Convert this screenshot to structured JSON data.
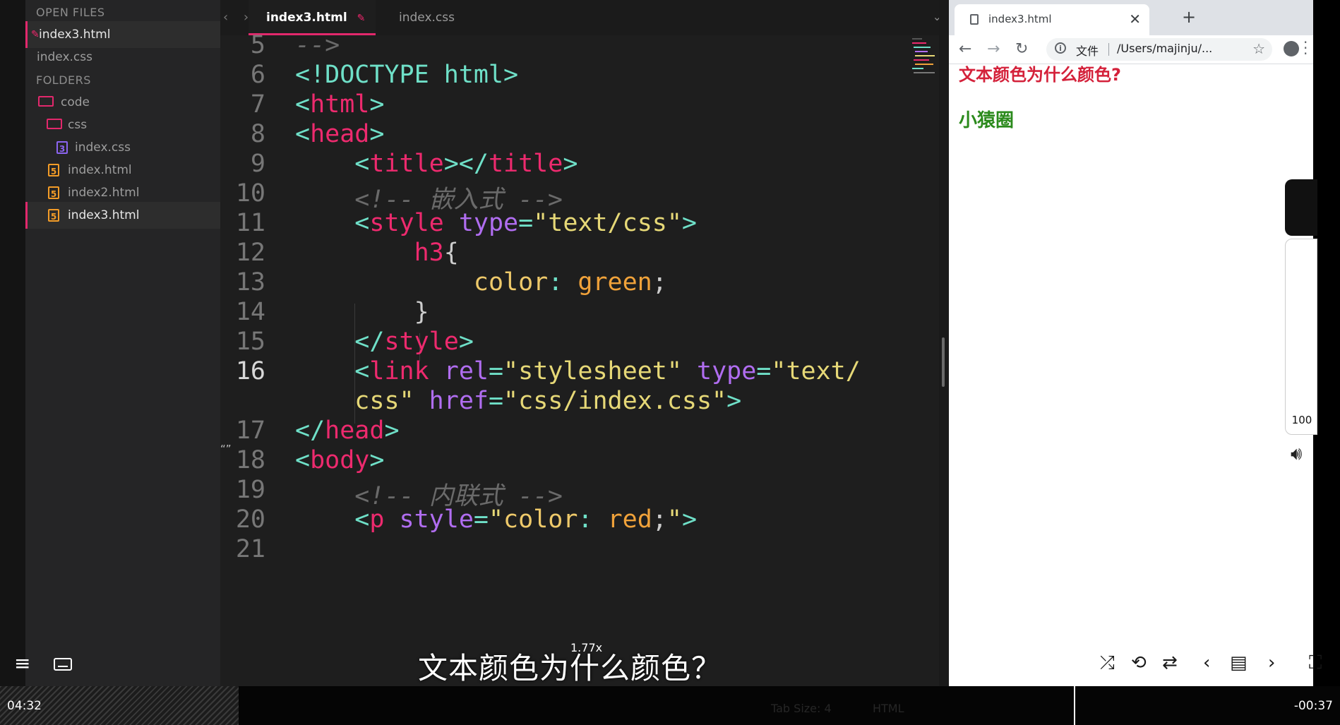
{
  "sidebar": {
    "open_files_heading": "OPEN FILES",
    "open_files": [
      {
        "name": "index3.html",
        "modified": true
      },
      {
        "name": "index.css",
        "modified": false
      }
    ],
    "folders_heading": "FOLDERS",
    "tree": [
      {
        "name": "code",
        "type": "folder"
      },
      {
        "name": "css",
        "type": "folder"
      },
      {
        "name": "index.css",
        "type": "css-file"
      },
      {
        "name": "index.html",
        "type": "html-file"
      },
      {
        "name": "index2.html",
        "type": "html-file"
      },
      {
        "name": "index3.html",
        "type": "html-file"
      }
    ]
  },
  "tabs": [
    {
      "label": "index3.html",
      "active": true
    },
    {
      "label": "index.css",
      "active": false
    }
  ],
  "code": {
    "line_numbers": [
      "5",
      "6",
      "7",
      "8",
      "9",
      "10",
      "11",
      "12",
      "13",
      "14",
      "15",
      "16",
      "17",
      "18",
      "19",
      "20",
      "21"
    ],
    "current_line": "16",
    "lines": {
      "l5": "-->",
      "l6_tag": "<!DOCTYPE html",
      "l7_tag": "html",
      "l8_tag": "head",
      "l9_tag1": "title",
      "l9_tag2": "title",
      "l10": "<!-- 嵌入式 -->",
      "l11_tag": "style",
      "l11_attr": "type",
      "l11_val": "\"text/css\"",
      "l12_sel": "h3",
      "l13_prop": "color",
      "l13_val": "green",
      "l15_tag": "style",
      "l16_tag": "link",
      "l16_attr1": "rel",
      "l16_val1": "\"stylesheet\"",
      "l16_attr2": "type",
      "l16_val2a": "\"text/",
      "l16_val2b": "css\"",
      "l16_attr3": "href",
      "l16_val3": "\"css/index.css\"",
      "l17_tag": "head",
      "l18_tag": "body",
      "l19": "<!-- 内联式 -->",
      "l20_tag": "p",
      "l20_attr": "style",
      "l20_q": "\"",
      "l20_prop": "color",
      "l20_val": "red",
      "l20_q2": "\""
    }
  },
  "overlay": {
    "caption": "文本颜色为什么颜色？",
    "speed": "1.77x"
  },
  "browser": {
    "tab_title": "index3.html",
    "close": "✕",
    "new_tab": "+",
    "omnibox_label": "文件",
    "omnibox_url": "/Users/majinju/...",
    "page_paragraph": "文本颜色为什么颜色?",
    "page_h3": "小猿圈"
  },
  "player": {
    "volume": "100",
    "time_elapsed": "04:32",
    "time_remaining": "-00:37"
  },
  "statusbar": {
    "tab_size": "Tab Size: 4",
    "syntax": "HTML"
  },
  "colors": {
    "accent": "#e2286c",
    "tag": "#ed2a6e",
    "bracket": "#6fe0c8",
    "attribute": "#b06df0",
    "string": "#e6d877",
    "value": "#f0a23a",
    "page_red": "#d4213a",
    "page_green": "#2b8a1c"
  }
}
